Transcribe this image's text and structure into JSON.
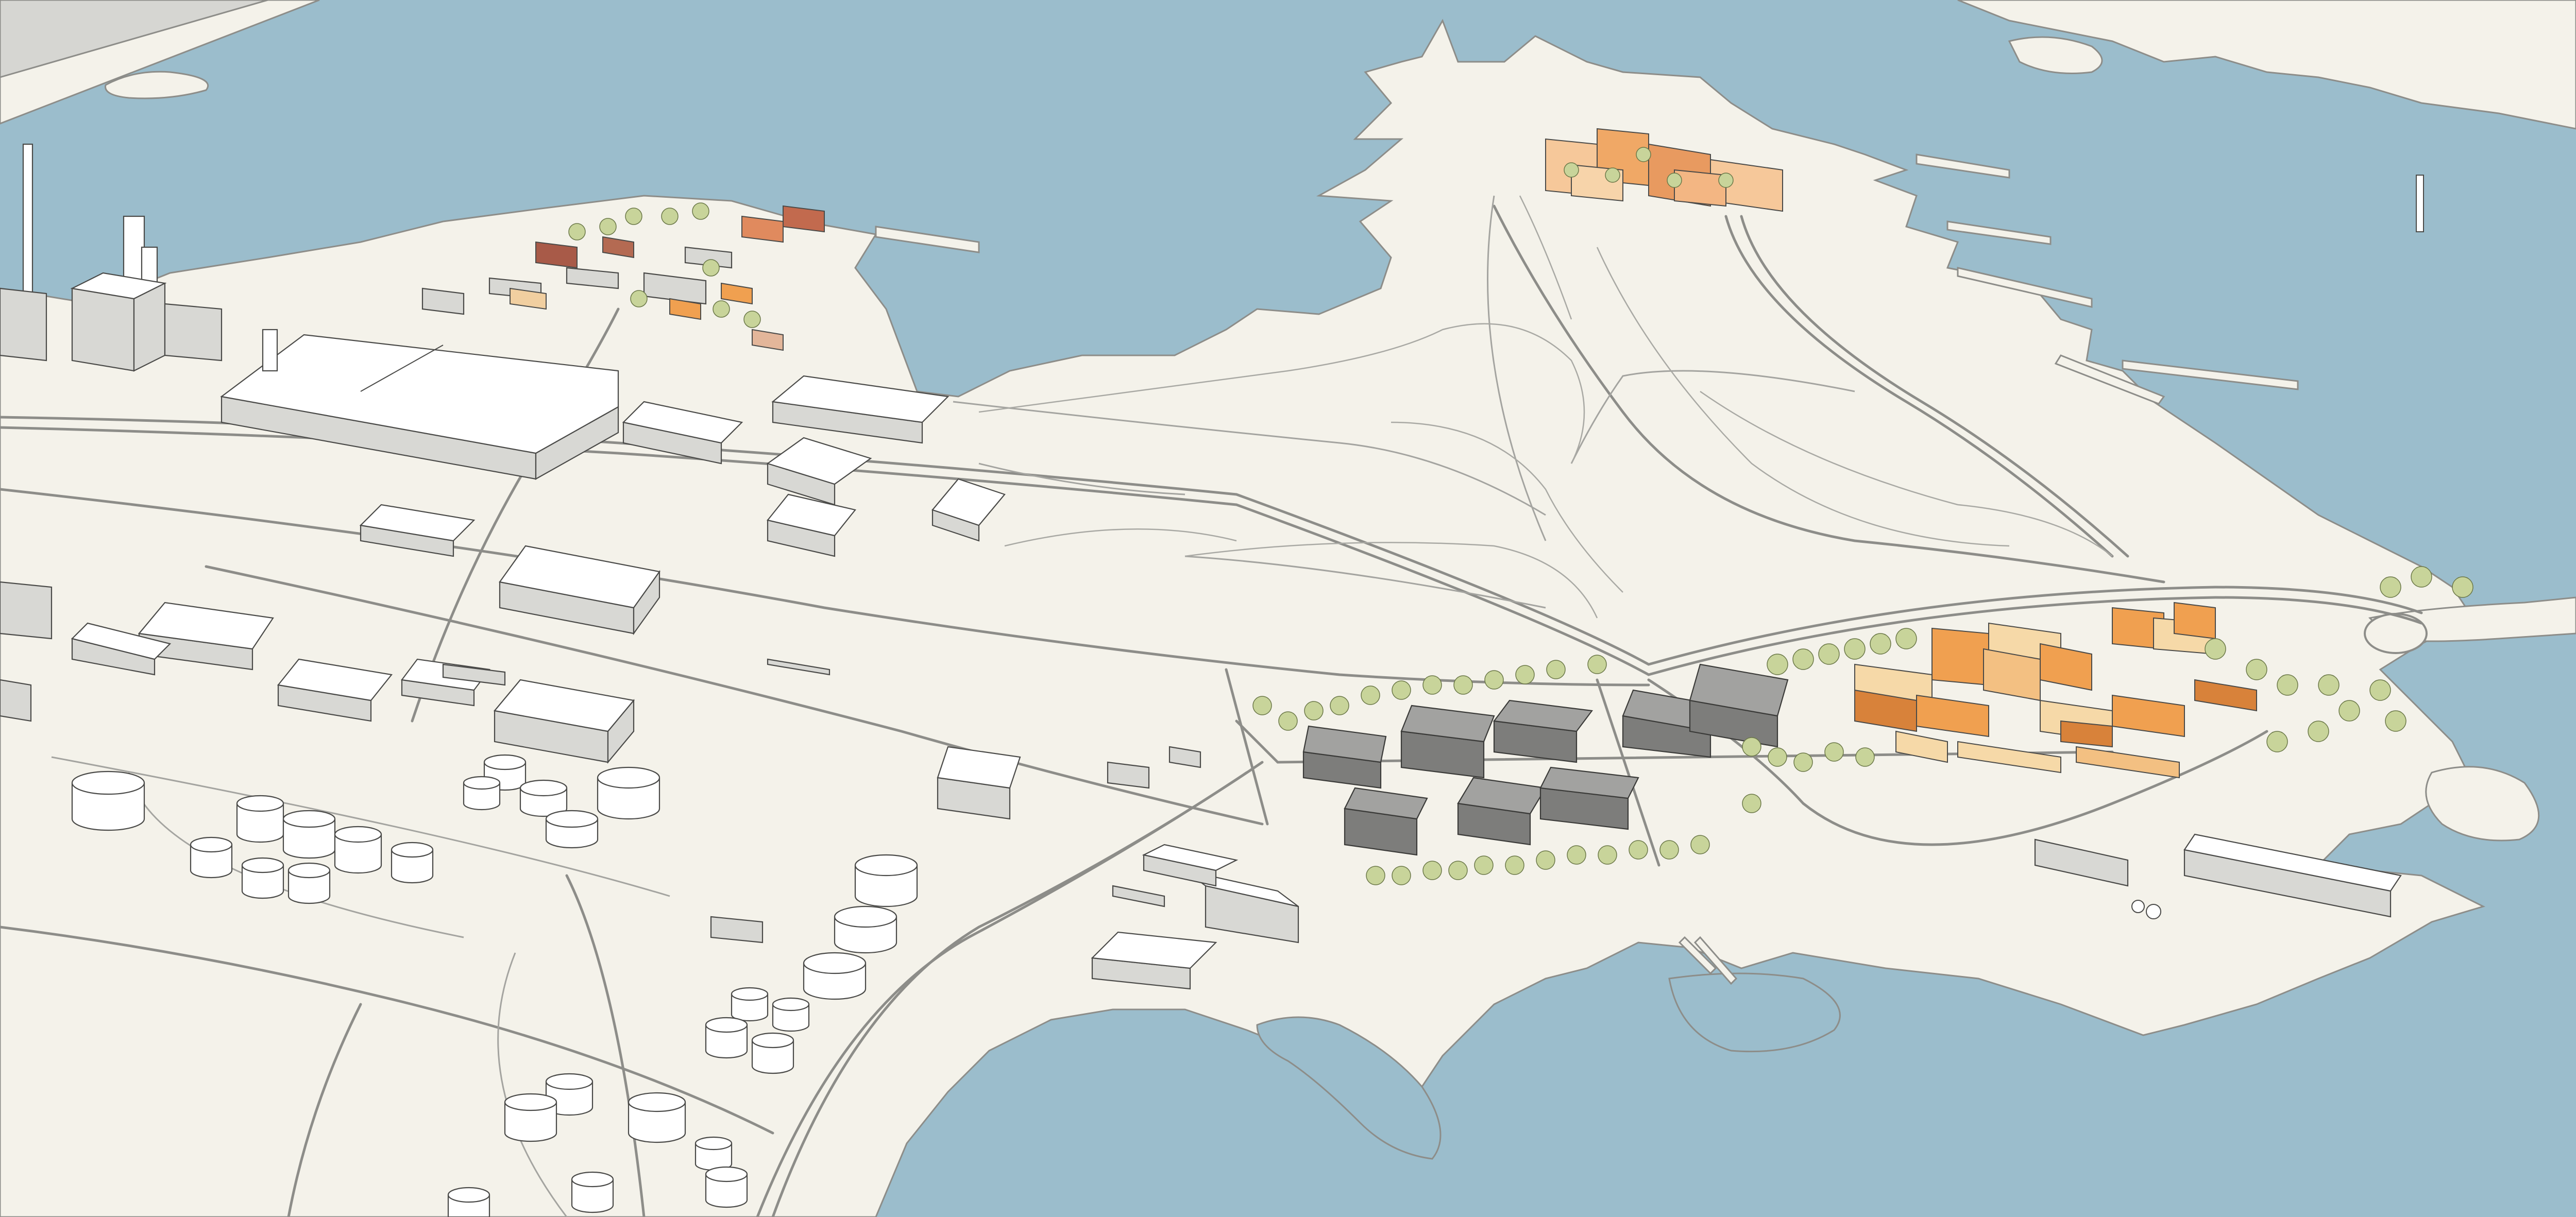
{
  "scene": {
    "kind": "3D massing model — coastal port and urban development plan (aerial oblique view)",
    "colors": {
      "water": "#9bbdcc",
      "land": "#f4f2ea",
      "road_line": "#8d8d89",
      "building_white": "#ffffff",
      "building_side": "#d8d8d4",
      "building_shade": "#c4c4bf",
      "building_gray": "#8a8a88",
      "building_gray_roof": "#a2a2a0",
      "proposed_orange": "#f0a050",
      "proposed_light": "#f6d9a8",
      "proposed_dark": "#d8823a",
      "brick": "#a85a48",
      "tree": "#c8d49a",
      "tree_dark": "#a3b56e",
      "outline": "#4a4a48"
    }
  }
}
